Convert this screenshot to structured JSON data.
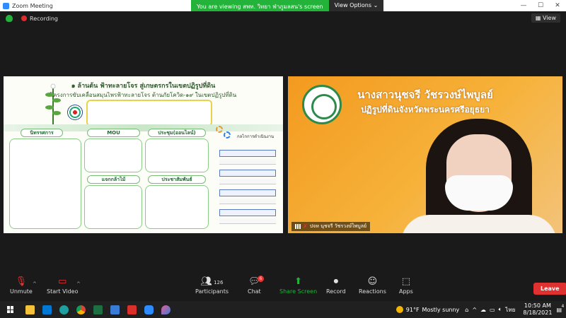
{
  "window": {
    "title": "Zoom Meeting",
    "controls": {
      "minimize": "—",
      "maximize": "☐",
      "close": "✕"
    }
  },
  "share_banner": {
    "message": "You are viewing สพท. วิทยา ฟ่าภูมลสน's screen",
    "options_label": "View Options ⌄"
  },
  "meeting": {
    "recording_label": "Recording",
    "view_label": "View"
  },
  "slide": {
    "title": "๑ ล้านต้น ฟ้าทะลายโจร สู่เกษตรกรในเขตปฏิรูปที่ดิน",
    "subtitle": "โครงการขับเคลื่อนสมุนไพรฟ้าทะลายโจร ต้านภัยโควิด-๑๙ ในเขตปฏิรูปที่ดิน",
    "box_headers": [
      "นิทรรศการ",
      "MOU",
      "ประชุม(ออนไลน์)",
      "แจกกล้าไม้",
      "ประชาสัมพันธ์"
    ],
    "right_title": "กลไกการดำเนินงาน"
  },
  "camera": {
    "name_title": "นางสาวนุชจรี วัชรวงษ์ไพบูลย์",
    "position_title": "ปฏิรูปที่ดินจังหวัดพระนครศรีอยุธยา",
    "participant_name": "ปจห นุชจรี วัชรวงษ์ไพบูลย์"
  },
  "toolbar": {
    "unmute": "Unmute",
    "start_video": "Start Video",
    "participants": "Participants",
    "participants_count": "126",
    "chat": "Chat",
    "chat_badge": "6",
    "share_screen": "Share Screen",
    "record": "Record",
    "reactions": "Reactions",
    "apps": "Apps",
    "leave": "Leave"
  },
  "taskbar": {
    "weather_temp": "91°F",
    "weather_desc": "Mostly sunny",
    "language": "ไทย",
    "time": "10:50 AM",
    "date": "8/18/2021",
    "notification_count": "4"
  },
  "colors": {
    "share_green": "#23b33a",
    "leave_red": "#e03131",
    "camera_orange": "#f39a1f"
  }
}
